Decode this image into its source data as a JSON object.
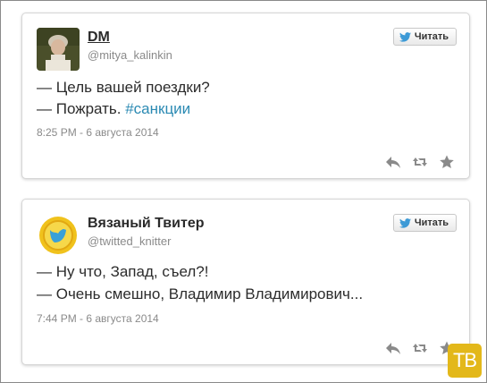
{
  "colors": {
    "hashtag": "#2b8ab3",
    "badge": "#e3b81a"
  },
  "tweets": [
    {
      "name": "DM",
      "handle": "@mitya_kalinkin",
      "follow_label": "Читать",
      "line1": "— Цель вашей поездки?",
      "line2_text": "— Пожрать. ",
      "line2_hashtag": "#санкции",
      "timestamp": "8:25 PM - 6 августа 2014",
      "icons": [
        "reply-icon",
        "retweet-icon",
        "favorite-icon"
      ]
    },
    {
      "name": "Вязаный Твитер",
      "handle": "@twitted_knitter",
      "follow_label": "Читать",
      "line1": "— Ну что, Запад, съел?!",
      "line2_text": "— Очень смешно, Владимир Владимирович...",
      "timestamp": "7:44 PM - 6 августа 2014",
      "icons": [
        "reply-icon",
        "retweet-icon",
        "favorite-icon"
      ]
    }
  ],
  "watermark": {
    "text": "ТВ"
  }
}
